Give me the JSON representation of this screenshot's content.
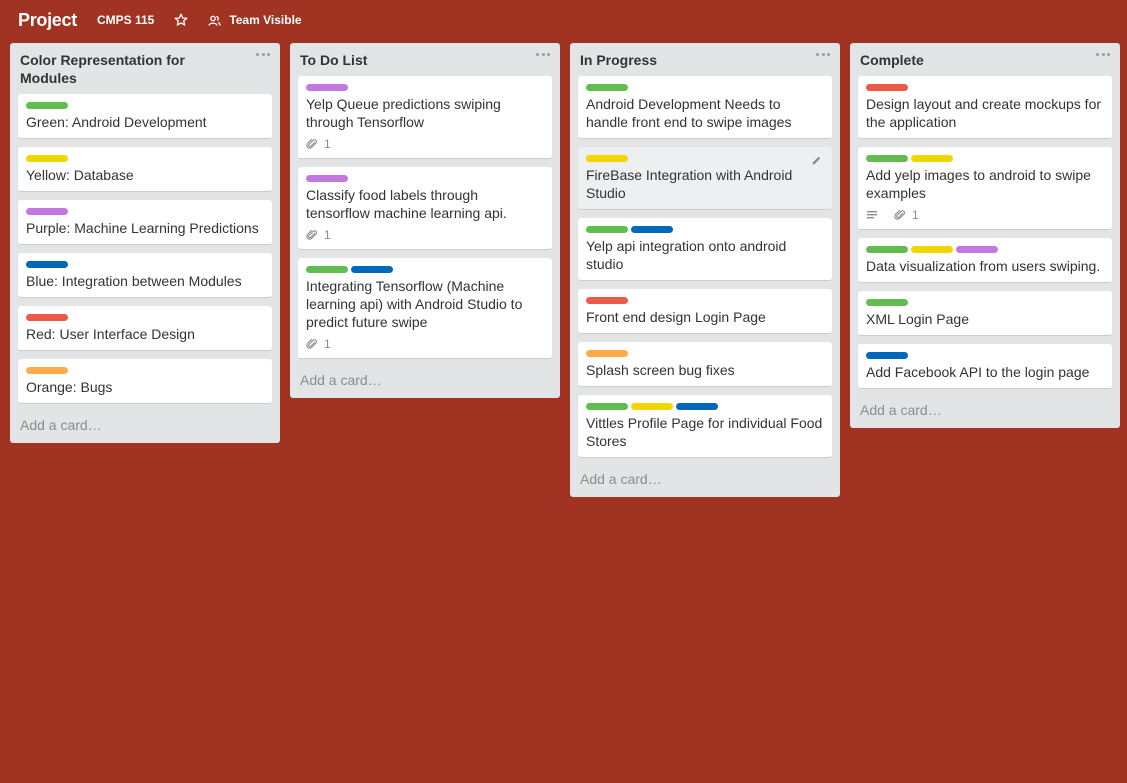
{
  "header": {
    "board_title": "Project",
    "org_name": "CMPS 115",
    "visibility": "Team Visible",
    "star_icon": "star-icon",
    "team_icon": "team-icon"
  },
  "colors": {
    "green": "#61bd4f",
    "yellow": "#f2d600",
    "purple": "#c377e0",
    "blue": "#0067b9",
    "red": "#eb5a46",
    "orange": "#ffab4a",
    "background": "#a03322"
  },
  "lists": [
    {
      "title": "Color Representation for Modules",
      "add_card": "Add a card…",
      "cards": [
        {
          "labels": [
            "green"
          ],
          "text": "Green: Android Development"
        },
        {
          "labels": [
            "yellow"
          ],
          "text": "Yellow: Database"
        },
        {
          "labels": [
            "purple"
          ],
          "text": "Purple: Machine Learning Predictions"
        },
        {
          "labels": [
            "blue"
          ],
          "text": "Blue: Integration between Modules"
        },
        {
          "labels": [
            "red"
          ],
          "text": "Red: User Interface Design"
        },
        {
          "labels": [
            "orange"
          ],
          "text": "Orange: Bugs"
        }
      ]
    },
    {
      "title": "To Do List",
      "add_card": "Add a card…",
      "cards": [
        {
          "labels": [
            "purple"
          ],
          "text": "Yelp Queue predictions swiping through Tensorflow",
          "attachments": "1"
        },
        {
          "labels": [
            "purple"
          ],
          "text": "Classify food labels through tensorflow machine learning api.",
          "attachments": "1"
        },
        {
          "labels": [
            "green",
            "blue"
          ],
          "text": "Integrating Tensorflow (Machine learning api) with Android Studio to predict future swipe",
          "attachments": "1"
        }
      ]
    },
    {
      "title": "In Progress",
      "add_card": "Add a card…",
      "cards": [
        {
          "labels": [
            "green"
          ],
          "text": "Android Development Needs to handle front end to swipe images"
        },
        {
          "labels": [
            "yellow"
          ],
          "text": "FireBase Integration with Android Studio",
          "hover": true
        },
        {
          "labels": [
            "green",
            "blue"
          ],
          "text": "Yelp api integration onto android studio"
        },
        {
          "labels": [
            "red"
          ],
          "text": "Front end design Login Page"
        },
        {
          "labels": [
            "orange"
          ],
          "text": "Splash screen bug fixes"
        },
        {
          "labels": [
            "green",
            "yellow",
            "blue"
          ],
          "text": "Vittles Profile Page for individual Food Stores"
        }
      ]
    },
    {
      "title": "Complete",
      "add_card": "Add a card…",
      "cards": [
        {
          "labels": [
            "red"
          ],
          "text": "Design layout and create mockups for the application"
        },
        {
          "labels": [
            "green",
            "yellow"
          ],
          "text": "Add yelp images to android to swipe examples",
          "description": true,
          "attachments": "1"
        },
        {
          "labels": [
            "green",
            "yellow",
            "purple"
          ],
          "text": "Data visualization from users swiping."
        },
        {
          "labels": [
            "green"
          ],
          "text": "XML Login Page"
        },
        {
          "labels": [
            "blue"
          ],
          "text": "Add Facebook API to the login page"
        }
      ]
    }
  ]
}
